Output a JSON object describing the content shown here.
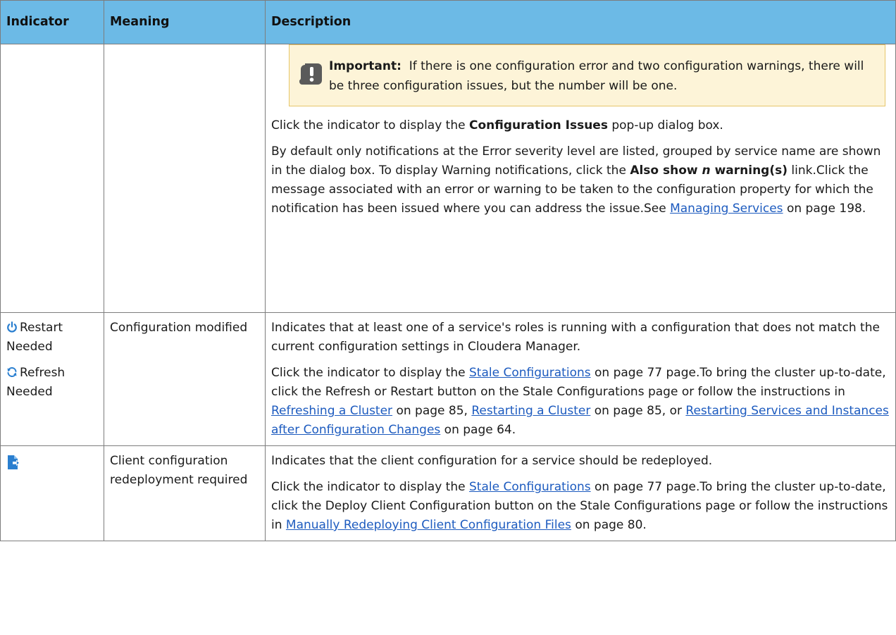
{
  "table": {
    "headers": {
      "indicator": "Indicator",
      "meaning": "Meaning",
      "description": "Description"
    },
    "row1": {
      "note": {
        "label": "Important:",
        "text": "If there is one configuration error and two configuration warnings, there will be three configuration issues, but the number will be one.",
        "icon": "exclamation-icon"
      },
      "p1_pre": "Click the indicator to display the ",
      "p1_bold": "Configuration Issues",
      "p1_post": " pop-up dialog box.",
      "p2_a": "By default only notifications at the Error severity level are listed, grouped by service name are shown in the dialog box. To display Warning notifications, click the ",
      "p2_bold1": "Also show ",
      "p2_bold_italic": "n",
      "p2_bold2": " warning(s)",
      "p2_b": " link.Click the message associated with an error or warning to be taken to the configuration property for which the notification has been issued where you can address the issue.See ",
      "p2_link": "Managing Services",
      "p2_c": " on page 198."
    },
    "row2": {
      "restart_label": "Restart Needed",
      "restart_icon": "power-icon",
      "refresh_label": "Refresh Needed",
      "refresh_icon": "refresh-icon",
      "meaning": "Configuration modified",
      "p1": "Indicates that at least one of a service's roles is running with a configuration that does not match the current configuration settings in Cloudera Manager.",
      "p2_a": "Click the indicator to display the ",
      "link1": "Stale Configurations",
      "p2_b": " on page 77 page.To bring the cluster up-to-date, click the Refresh or Restart button on the Stale Configurations page or follow the instructions in ",
      "link2": "Refreshing a Cluster",
      "p2_c": " on page 85, ",
      "link3": "Restarting a Cluster",
      "p2_d": " on page 85, or ",
      "link4": "Restarting Services and Instances after Configuration Changes",
      "p2_e": " on page 64."
    },
    "row3": {
      "indicator_icon": "deploy-client-config-icon",
      "meaning": "Client configuration redeployment required",
      "p1": "Indicates that the client configuration for a service should be redeployed.",
      "p2_a": "Click the indicator to display the ",
      "link1": "Stale Configurations",
      "p2_b": " on page 77 page.To bring the cluster up-to-date, click the Deploy Client Configuration button on the Stale Configurations page or follow the instructions in ",
      "link2": "Manually Redeploying Client Configuration Files",
      "p2_c": " on page 80."
    }
  },
  "colors": {
    "header_bg": "#6cbae6",
    "note_bg": "#fdf4d8",
    "note_border": "#e6c66a",
    "link": "#1d5bbf",
    "icon_blue": "#2a7fd0"
  }
}
